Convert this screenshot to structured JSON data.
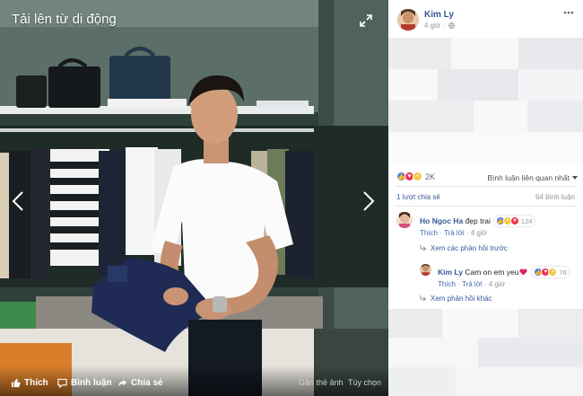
{
  "viewer": {
    "title": "Tải lên từ di động",
    "actions": {
      "like": "Thích",
      "comment": "Bình luận",
      "share": "Chia sẻ",
      "tag": "Gắn thẻ ảnh",
      "options": "Tùy chọn"
    }
  },
  "post": {
    "author": "Kim Ly",
    "time": "4 giờ",
    "reaction_count": "2K",
    "sort_label": "Bình luận liên quan nhất",
    "shares": "1 lượt chia sẻ",
    "comments": "64 bình luận"
  },
  "comments": [
    {
      "name": "Ho Ngoc Ha",
      "text": "đẹp trai",
      "reactions": "124",
      "like": "Thích",
      "reply": "Trả lời",
      "time": "4 giờ",
      "view_replies": "Xem các phản hồi trước"
    },
    {
      "name": "Kim Ly",
      "text": "Cam on em yeu",
      "reactions": "76",
      "like": "Thích",
      "reply": "Trả lời",
      "time": "4 giờ",
      "more_replies": "Xem phản hồi khác"
    }
  ],
  "icons": {
    "expand": "expand-icon",
    "more": "more-options-icon",
    "globe": "globe-icon",
    "like": "thumbs-up-icon",
    "comment": "speech-bubble-icon",
    "share": "share-arrow-icon"
  },
  "colors": {
    "link": "#365899",
    "like": "#4f7ee7",
    "love": "#f0344c",
    "wow": "#f7c94a"
  }
}
